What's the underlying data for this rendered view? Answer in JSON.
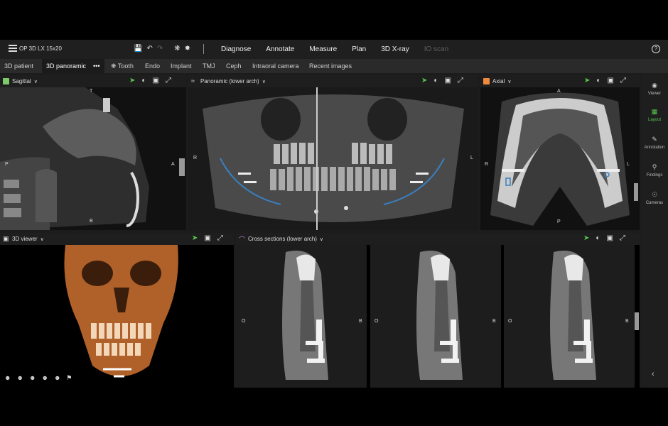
{
  "document": {
    "title": "OP 3D LX 15x20"
  },
  "toolbar": {
    "icons": [
      "save-icon",
      "undo-icon",
      "redo-icon",
      "tooth-chart-icon",
      "settings-wheel-icon"
    ],
    "menus": [
      "Diagnose",
      "Annotate",
      "Measure",
      "Plan",
      "3D X-ray",
      "IO scan"
    ],
    "help_label": "?"
  },
  "tabs": [
    "3D patient",
    "3D panoramic",
    "Tooth",
    "Endo",
    "Implant",
    "TMJ",
    "Ceph",
    "Intraoral camera",
    "Recent images"
  ],
  "tab_more": "•••",
  "active_tab": "3D panoramic",
  "panels": {
    "sagittal": {
      "title": "Sagittal",
      "color": "#7ec96a",
      "labels": {
        "top": "T",
        "left": "P",
        "right": "A",
        "bottom": "B"
      }
    },
    "panoramic": {
      "title": "Panoramic (lower arch)",
      "labels": {
        "left": "R",
        "right": "L"
      }
    },
    "axial": {
      "title": "Axial",
      "color": "#f08a3c",
      "labels": {
        "top": "A",
        "left": "R",
        "right": "L",
        "bottom": "P"
      }
    },
    "viewer3d": {
      "title": "3D viewer"
    },
    "cross": {
      "title": "Cross sections (lower arch)",
      "labels": {
        "left": "O",
        "right": "B"
      }
    }
  },
  "sidebar": {
    "items": [
      {
        "label": "Viewer",
        "icon": "eye-icon"
      },
      {
        "label": "Layout",
        "icon": "layout-icon"
      },
      {
        "label": "Annotation",
        "icon": "pen-icon"
      },
      {
        "label": "Findings",
        "icon": "findings-icon"
      },
      {
        "label": "Cameras",
        "icon": "camera-icon"
      }
    ],
    "active": "Layout"
  },
  "colors": {
    "accent": "#58c94f",
    "implant_outline": "#3a7fbf"
  }
}
